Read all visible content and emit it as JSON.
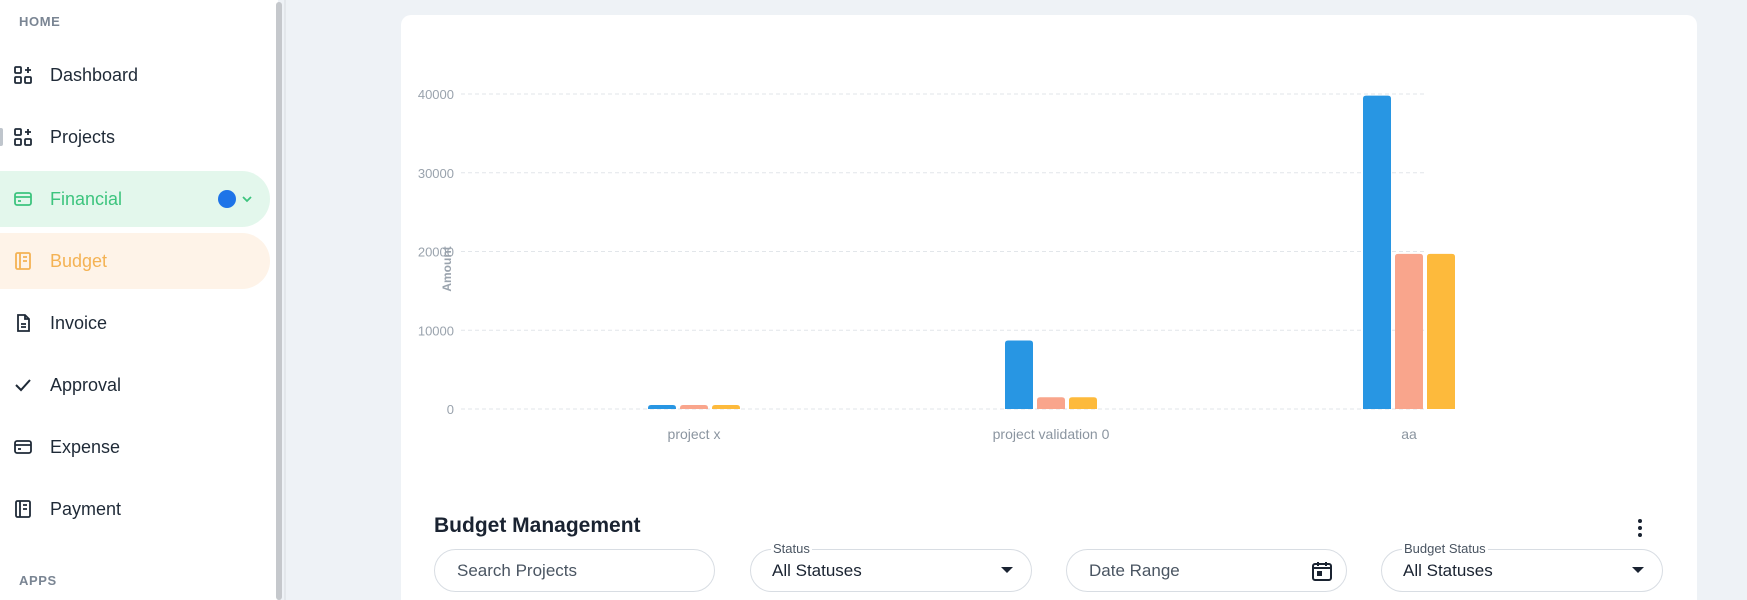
{
  "sidebar": {
    "section_home": "HOME",
    "section_apps": "APPS",
    "items": [
      {
        "label": "Dashboard",
        "icon": "dashboard-icon"
      },
      {
        "label": "Projects",
        "icon": "projects-icon"
      },
      {
        "label": "Financial",
        "icon": "financial-icon",
        "state": "expanded"
      },
      {
        "label": "Budget",
        "icon": "budget-icon",
        "state": "selected"
      },
      {
        "label": "Invoice",
        "icon": "invoice-icon"
      },
      {
        "label": "Approval",
        "icon": "check-icon"
      },
      {
        "label": "Expense",
        "icon": "expense-icon"
      },
      {
        "label": "Payment",
        "icon": "payment-icon"
      }
    ]
  },
  "colors": {
    "green_accent": "#3dc47e",
    "green_bg": "#e3f7ec",
    "orange_accent": "#f4b253",
    "orange_bg": "#fef3e8",
    "blue_dot": "#1e74e8"
  },
  "chart_data": {
    "type": "bar",
    "categories": [
      "project x",
      "project validation 0",
      "aa"
    ],
    "series": [
      {
        "values": [
          300,
          8700,
          39800
        ],
        "color": "#2896e3"
      },
      {
        "values": [
          300,
          1500,
          19700
        ],
        "color": "#f9a58c"
      },
      {
        "values": [
          300,
          1500,
          19700
        ],
        "color": "#fdba3c"
      }
    ],
    "ylabel": "Amount",
    "ylim": [
      0,
      40000
    ],
    "yticks": [
      "0",
      "10000",
      "20000",
      "30000",
      "40000"
    ],
    "grid": true
  },
  "budget_management": {
    "title": "Budget Management",
    "search_placeholder": "Search Projects",
    "status_label": "Status",
    "status_value": "All Statuses",
    "date_range_placeholder": "Date Range",
    "budget_status_label": "Budget Status",
    "budget_status_value": "All Statuses"
  }
}
